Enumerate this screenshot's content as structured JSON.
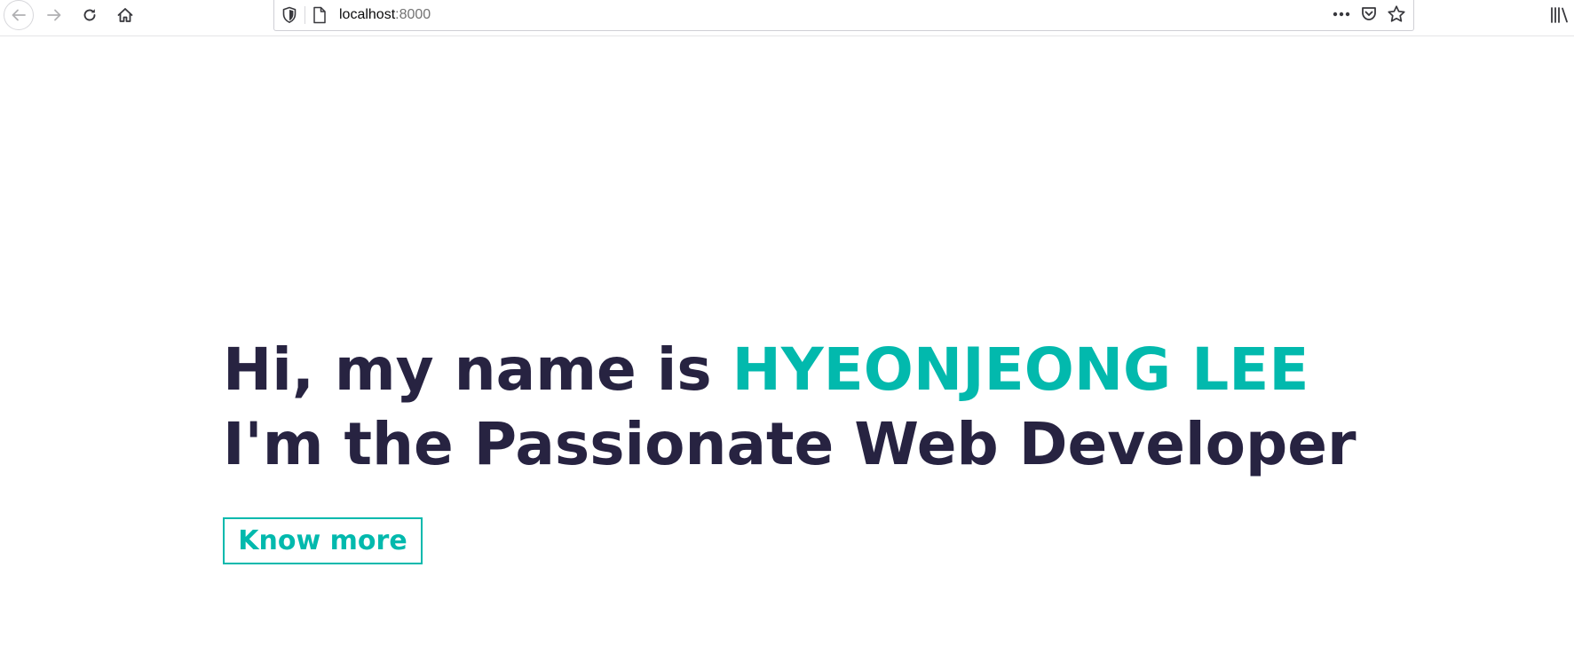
{
  "browser": {
    "url_host": "localhost",
    "url_port": ":8000",
    "icons": {
      "back": "arrow-left-icon",
      "forward": "arrow-right-icon",
      "reload": "reload-icon",
      "home": "home-icon",
      "shield": "shield-icon",
      "page": "page-icon",
      "more": "more-icon",
      "pocket": "pocket-icon",
      "bookmark": "star-icon",
      "library": "library-icon"
    }
  },
  "hero": {
    "line1_prefix": "Hi, my name is ",
    "name": "HYEONJEONG LEE",
    "line2": "I'm the Passionate Web Developer",
    "cta_label": "Know more"
  },
  "colors": {
    "text_dark": "#272341",
    "accent": "#02b9ad"
  }
}
